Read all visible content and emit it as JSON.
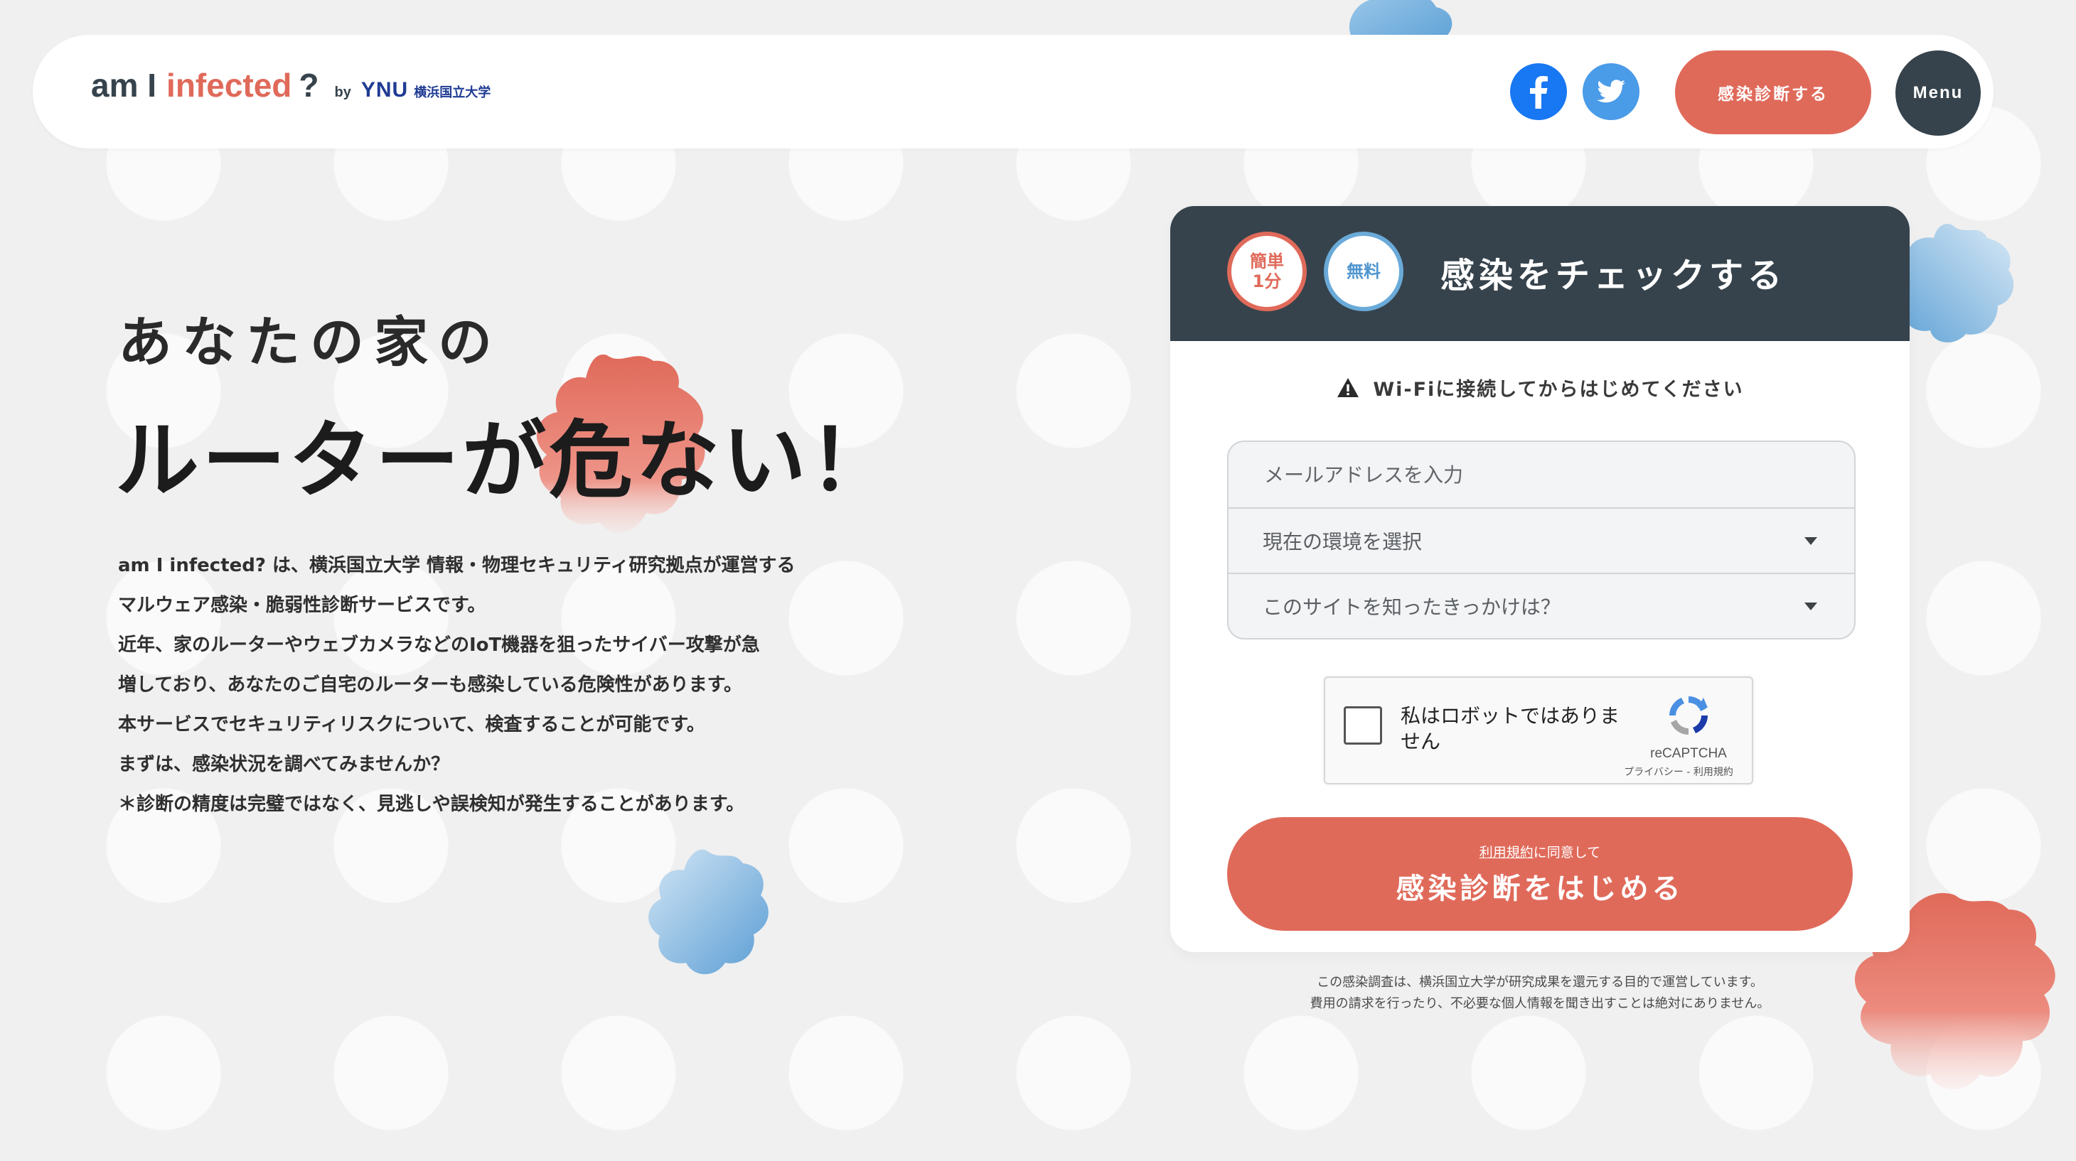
{
  "header": {
    "logo": {
      "am": "am I",
      "infected": "infected",
      "question": "?",
      "by": "by",
      "ynu": "YNU",
      "university": "横浜国立大学"
    },
    "facebook_icon": "facebook-icon",
    "twitter_icon": "twitter-icon",
    "diagnose_button": "感染診断する",
    "menu_button": "Menu"
  },
  "hero": {
    "line1": "あなたの家の",
    "line2": "ルーターが危ない！",
    "description": [
      "am I infected? は、横浜国立大学 情報・物理セキュリティ研究拠点が運営する",
      "マルウェア感染・脆弱性診断サービスです。",
      "近年、家のルーターやウェブカメラなどのIoT機器を狙ったサイバー攻撃が急",
      "増しており、あなたのご自宅のルーターも感染している危険性があります。",
      "本サービスでセキュリティリスクについて、検査することが可能です。",
      "まずは、感染状況を調べてみませんか？",
      "＊診断の精度は完璧ではなく、見逃しや誤検知が発生することがあります。"
    ]
  },
  "form": {
    "badge_simple": [
      "簡単",
      "1分"
    ],
    "badge_free": "無料",
    "title": "感染をチェックする",
    "wifi_note": "Wi-Fiに接続してからはじめてください",
    "email_placeholder": "メールアドレスを入力",
    "environment_select": "現在の環境を選択",
    "referral_select": "このサイトを知ったきっかけは？",
    "captcha": {
      "label": "私はロボットではありません",
      "brand": "reCAPTCHA",
      "links": "プライバシー - 利用規約"
    },
    "submit": {
      "terms_link": "利用規約",
      "agree_suffix": "に同意して",
      "label": "感染診断をはじめる"
    },
    "disclaimer": [
      "この感染調査は、横浜国立大学が研究成果を還元する目的で運営しています。",
      "費用の請求を行ったり、不必要な個人情報を聞き出すことは絶対にありません。"
    ]
  },
  "colors": {
    "accent_red": "#e06a5a",
    "dark_navy": "#36434c",
    "blue": "#6aaad8",
    "background": "#f0f0f0"
  }
}
